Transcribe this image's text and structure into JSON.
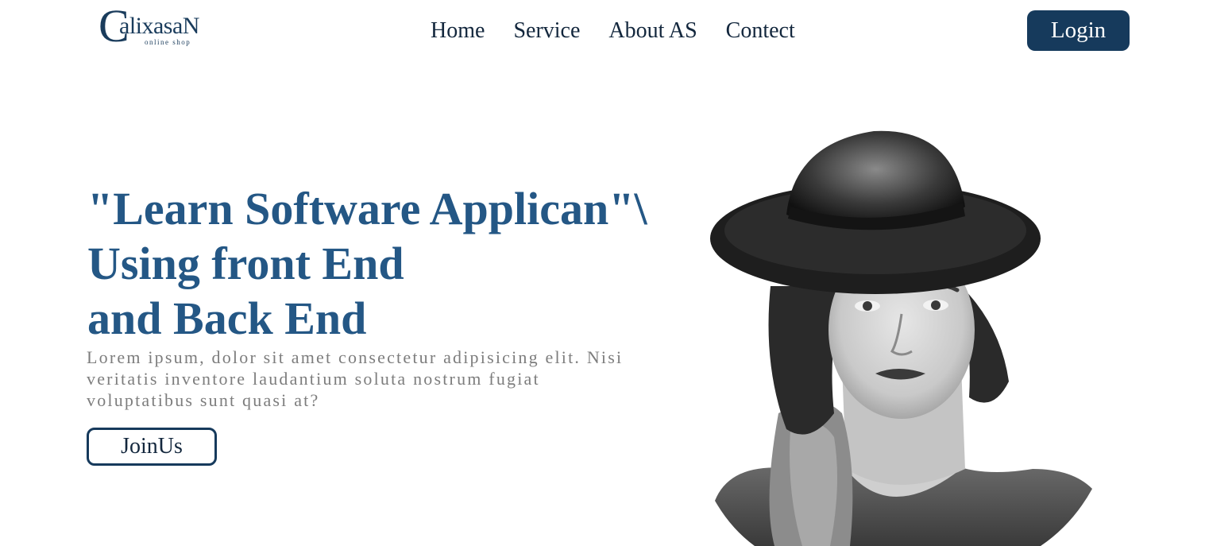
{
  "header": {
    "logo": {
      "initial": "C",
      "word": "alixasaN",
      "tagline": "online shop"
    },
    "nav": [
      {
        "label": "Home"
      },
      {
        "label": "Service"
      },
      {
        "label": "About AS"
      },
      {
        "label": "Contect"
      }
    ],
    "login_label": "Login"
  },
  "hero": {
    "title_lines": [
      "\"Learn Software Applican\"\\",
      "Using front End",
      "and Back End"
    ],
    "description": "Lorem ipsum, dolor sit amet consectetur adipisicing elit. Nisi veritatis inventore laudantium soluta nostrum fugiat voluptatibus sunt quasi at?",
    "cta_label": "JoinUs",
    "image": {
      "subject": "black-and-white portrait of a woman wearing a wide-brim hat"
    }
  },
  "colors": {
    "brand_dark": "#163a5c",
    "title_blue": "#245785",
    "text_gray": "#7d7d7d",
    "background": "#ffffff"
  }
}
